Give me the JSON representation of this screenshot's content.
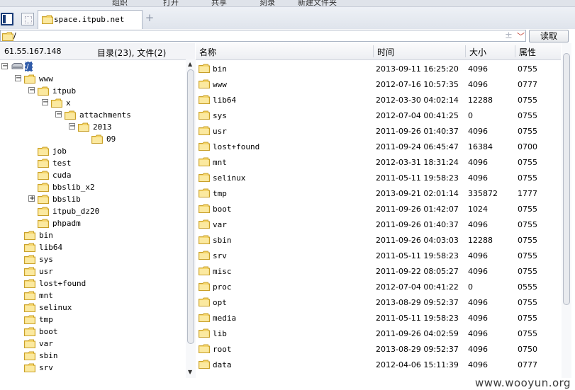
{
  "top_toolbar": [
    "组织",
    "打开",
    "共享",
    "刻录",
    "新建文件夹"
  ],
  "tabs": {
    "active_label": "space.itpub.net"
  },
  "address": {
    "path": "/",
    "read_button": "读取"
  },
  "left_header": {
    "ip": "61.55.167.148",
    "count": "目录(23), 文件(2)"
  },
  "columns": {
    "name": "名称",
    "time": "时间",
    "size": "大小",
    "perm": "属性"
  },
  "tree": [
    {
      "label": "/",
      "depth": 0,
      "expander": "-",
      "type": "drive"
    },
    {
      "label": "www",
      "depth": 1,
      "expander": "-"
    },
    {
      "label": "itpub",
      "depth": 2,
      "expander": "-"
    },
    {
      "label": "x",
      "depth": 3,
      "expander": "-"
    },
    {
      "label": "attachments",
      "depth": 4,
      "expander": "-"
    },
    {
      "label": "2013",
      "depth": 5,
      "expander": "-"
    },
    {
      "label": "09",
      "depth": 6,
      "expander": ""
    },
    {
      "label": "job",
      "depth": 2,
      "expander": ""
    },
    {
      "label": "test",
      "depth": 2,
      "expander": ""
    },
    {
      "label": "cuda",
      "depth": 2,
      "expander": ""
    },
    {
      "label": "bbslib_x2",
      "depth": 2,
      "expander": ""
    },
    {
      "label": "bbslib",
      "depth": 2,
      "expander": "+"
    },
    {
      "label": "itpub_dz20",
      "depth": 2,
      "expander": ""
    },
    {
      "label": "phpadm",
      "depth": 2,
      "expander": ""
    },
    {
      "label": "bin",
      "depth": 1,
      "expander": ""
    },
    {
      "label": "lib64",
      "depth": 1,
      "expander": ""
    },
    {
      "label": "sys",
      "depth": 1,
      "expander": ""
    },
    {
      "label": "usr",
      "depth": 1,
      "expander": ""
    },
    {
      "label": "lost+found",
      "depth": 1,
      "expander": ""
    },
    {
      "label": "mnt",
      "depth": 1,
      "expander": ""
    },
    {
      "label": "selinux",
      "depth": 1,
      "expander": ""
    },
    {
      "label": "tmp",
      "depth": 1,
      "expander": ""
    },
    {
      "label": "boot",
      "depth": 1,
      "expander": ""
    },
    {
      "label": "var",
      "depth": 1,
      "expander": ""
    },
    {
      "label": "sbin",
      "depth": 1,
      "expander": ""
    },
    {
      "label": "srv",
      "depth": 1,
      "expander": ""
    }
  ],
  "files": [
    {
      "name": "bin",
      "time": "2013-09-11 16:25:20",
      "size": "4096",
      "perm": "0755"
    },
    {
      "name": "www",
      "time": "2012-07-16 10:57:35",
      "size": "4096",
      "perm": "0777"
    },
    {
      "name": "lib64",
      "time": "2012-03-30 04:02:14",
      "size": "12288",
      "perm": "0755"
    },
    {
      "name": "sys",
      "time": "2012-07-04 00:41:25",
      "size": "0",
      "perm": "0755"
    },
    {
      "name": "usr",
      "time": "2011-09-26 01:40:37",
      "size": "4096",
      "perm": "0755"
    },
    {
      "name": "lost+found",
      "time": "2011-09-24 06:45:47",
      "size": "16384",
      "perm": "0700"
    },
    {
      "name": "mnt",
      "time": "2012-03-31 18:31:24",
      "size": "4096",
      "perm": "0755"
    },
    {
      "name": "selinux",
      "time": "2011-05-11 19:58:23",
      "size": "4096",
      "perm": "0755"
    },
    {
      "name": "tmp",
      "time": "2013-09-21 02:01:14",
      "size": "335872",
      "perm": "1777"
    },
    {
      "name": "boot",
      "time": "2011-09-26 01:42:07",
      "size": "1024",
      "perm": "0755"
    },
    {
      "name": "var",
      "time": "2011-09-26 01:40:37",
      "size": "4096",
      "perm": "0755"
    },
    {
      "name": "sbin",
      "time": "2011-09-26 04:03:03",
      "size": "12288",
      "perm": "0755"
    },
    {
      "name": "srv",
      "time": "2011-05-11 19:58:23",
      "size": "4096",
      "perm": "0755"
    },
    {
      "name": "misc",
      "time": "2011-09-22 08:05:27",
      "size": "4096",
      "perm": "0755"
    },
    {
      "name": "proc",
      "time": "2012-07-04 00:41:22",
      "size": "0",
      "perm": "0555"
    },
    {
      "name": "opt",
      "time": "2013-08-29 09:52:37",
      "size": "4096",
      "perm": "0755"
    },
    {
      "name": "media",
      "time": "2011-05-11 19:58:23",
      "size": "4096",
      "perm": "0755"
    },
    {
      "name": "lib",
      "time": "2011-09-26 04:02:59",
      "size": "4096",
      "perm": "0755"
    },
    {
      "name": "root",
      "time": "2013-08-29 09:52:37",
      "size": "4096",
      "perm": "0750"
    },
    {
      "name": "data",
      "time": "2012-04-06 15:11:39",
      "size": "4096",
      "perm": "0777"
    }
  ],
  "watermark": "www.wooyun.org",
  "colors": {
    "folder": "#f5d56a",
    "folder_edge": "#c8a02a",
    "selection": "#2f5aa8"
  }
}
